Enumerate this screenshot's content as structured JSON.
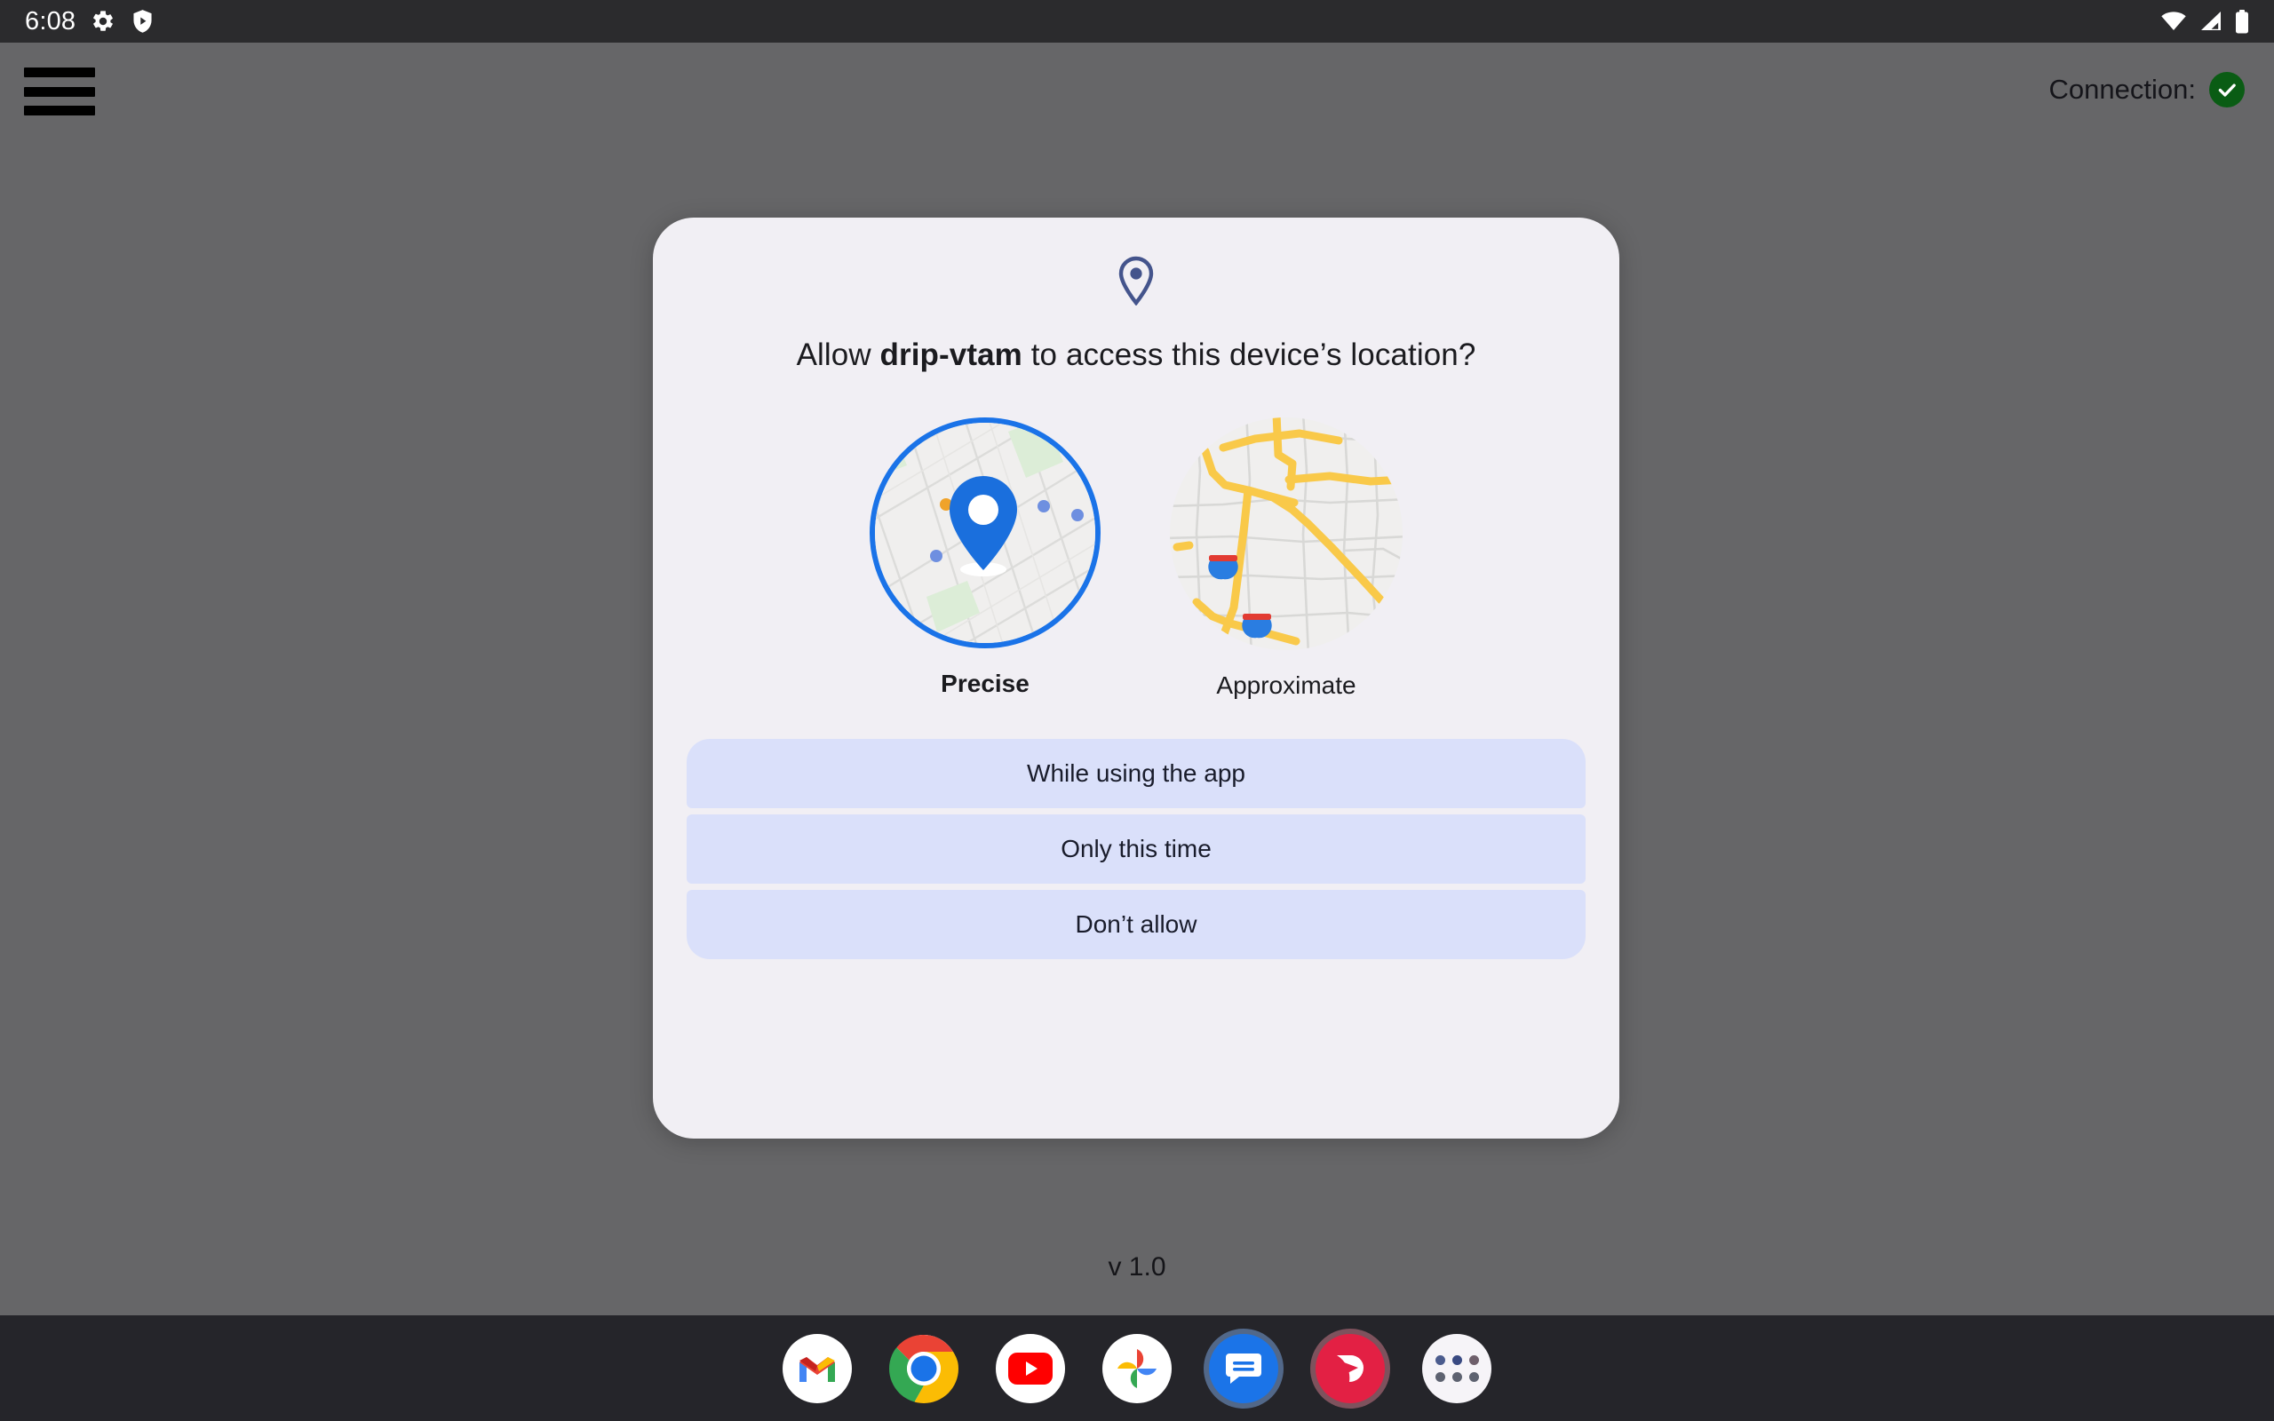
{
  "statusbar": {
    "time": "6:08",
    "left_icons": [
      {
        "name": "settings-gear-icon"
      },
      {
        "name": "shield-play-icon"
      }
    ],
    "right_icons": [
      {
        "name": "wifi-icon"
      },
      {
        "name": "cellular-signal-icon"
      },
      {
        "name": "battery-icon"
      }
    ]
  },
  "header": {
    "menu_icon": "hamburger-menu-icon",
    "connection_label": "Connection:",
    "connection_status_icon": "check-circle-icon",
    "connection_status_color": "#0a5c14"
  },
  "dialog": {
    "pin_icon": "location-pin-icon",
    "pin_color": "#44548c",
    "title_prefix": "Allow ",
    "title_app": "drip-vtam",
    "title_suffix": " to access this device’s location?",
    "options": [
      {
        "label": "Precise",
        "selected": true,
        "map_icon": "precise-location-map",
        "ring_color": "#1a73e8"
      },
      {
        "label": "Approximate",
        "selected": false,
        "map_icon": "approximate-location-map",
        "ring_color": ""
      }
    ],
    "buttons": [
      {
        "label": "While using the app",
        "name": "while-using-the-app-button"
      },
      {
        "label": "Only this time",
        "name": "only-this-time-button"
      },
      {
        "label": "Don’t allow",
        "name": "dont-allow-button"
      }
    ],
    "button_bg": "#dae0fa",
    "surface_color": "#f1eff4"
  },
  "footer": {
    "version": "v 1.0"
  },
  "dock": {
    "items": [
      {
        "name": "gmail-icon",
        "label": "Gmail"
      },
      {
        "name": "chrome-icon",
        "label": "Chrome"
      },
      {
        "name": "youtube-icon",
        "label": "YouTube"
      },
      {
        "name": "google-photos-icon",
        "label": "Photos"
      },
      {
        "name": "messages-icon",
        "label": "Messages"
      },
      {
        "name": "shortcut-app-icon",
        "label": "Shortcut"
      },
      {
        "name": "app-drawer-icon",
        "label": "All apps"
      }
    ]
  },
  "background_color": "#666668"
}
